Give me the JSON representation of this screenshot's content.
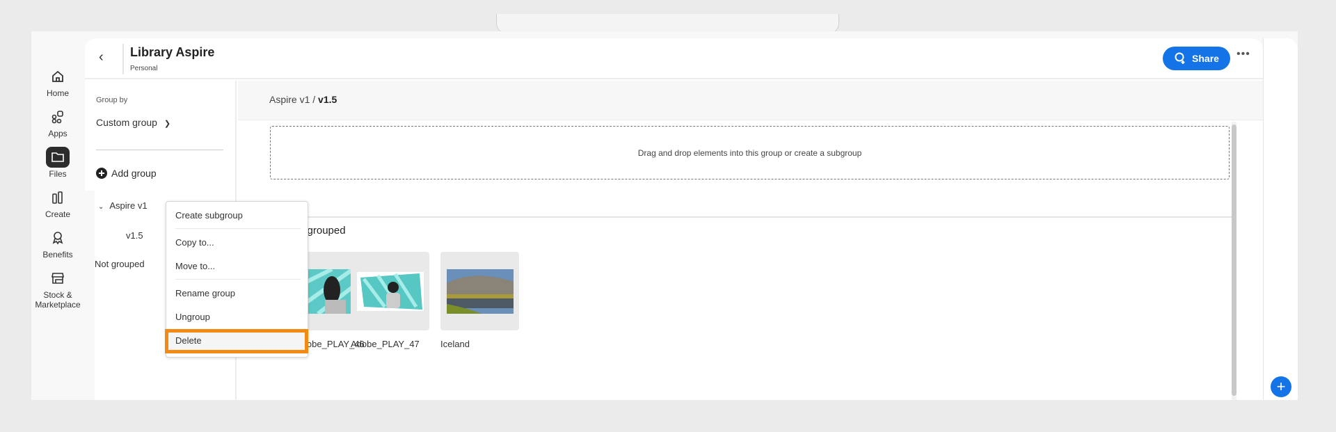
{
  "nav": [
    {
      "label": "Home",
      "icon": "home-icon"
    },
    {
      "label": "Apps",
      "icon": "apps-icon"
    },
    {
      "label": "Files",
      "icon": "folder-icon",
      "active": true
    },
    {
      "label": "Create",
      "icon": "create-icon"
    },
    {
      "label": "Benefits",
      "icon": "award-icon"
    },
    {
      "label": "Stock &\nMarketplace",
      "icon": "store-icon"
    }
  ],
  "header": {
    "title": "Library Aspire",
    "subtitle": "Personal",
    "share": "Share",
    "more": "•••"
  },
  "groups": {
    "group_by": "Group by",
    "select": "Custom group",
    "add": "Add group",
    "tree": [
      "Aspire v1",
      "v1.5",
      "Not grouped"
    ]
  },
  "breadcrumb": {
    "parent": "Aspire v1 / ",
    "current": "v1.5"
  },
  "dropzone": "Drag and drop elements into this group or create a subgroup",
  "section_title": "Not grouped",
  "assets": [
    {
      "name": "Adobe_PLAY_46"
    },
    {
      "name": "Adobe_PLAY_47"
    },
    {
      "name": "Iceland"
    }
  ],
  "menu": [
    "Create subgroup",
    "Copy to...",
    "Move to...",
    "Rename group",
    "Ungroup",
    "Delete"
  ],
  "colors": {
    "accent": "#1473e6",
    "highlight": "#f28a14"
  }
}
